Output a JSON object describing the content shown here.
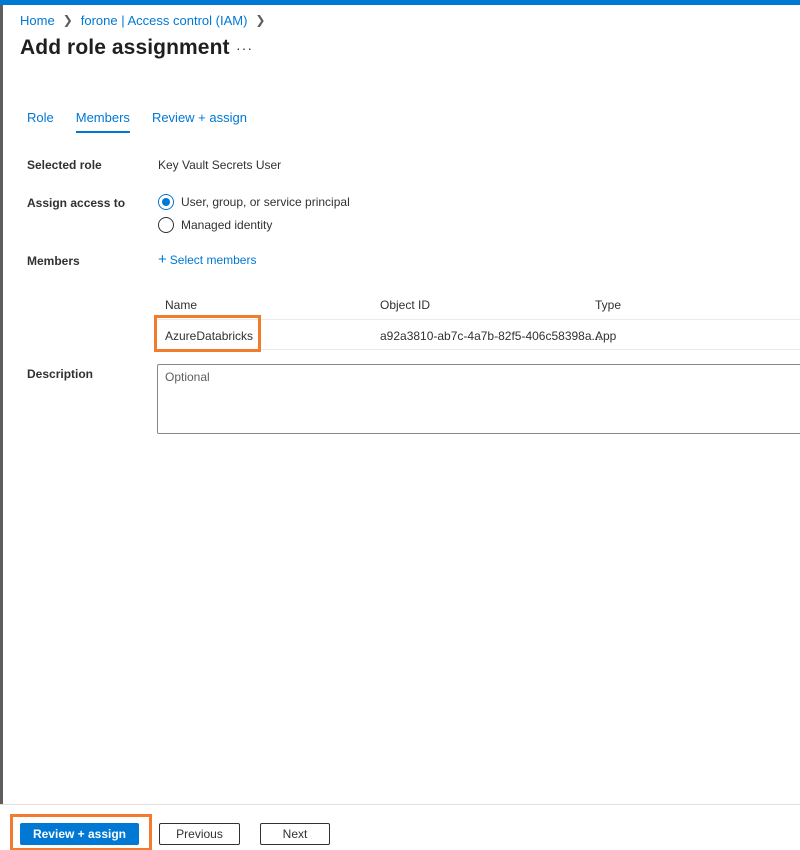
{
  "breadcrumb": {
    "items": [
      "Home",
      "forone | Access control (IAM)"
    ]
  },
  "page": {
    "title": "Add role assignment",
    "more": "···"
  },
  "tabs": [
    {
      "label": "Role"
    },
    {
      "label": "Members"
    },
    {
      "label": "Review + assign"
    }
  ],
  "form": {
    "selected_role_label": "Selected role",
    "selected_role_value": "Key Vault Secrets User",
    "assign_access_label": "Assign access to",
    "assign_options": [
      "User, group, or service principal",
      "Managed identity"
    ],
    "members_label": "Members",
    "select_members": "Select members",
    "description_label": "Description",
    "description_placeholder": "Optional"
  },
  "members_table": {
    "columns": [
      "Name",
      "Object ID",
      "Type"
    ],
    "rows": [
      {
        "name": "AzureDatabricks",
        "object_id": "a92a3810-ab7c-4a7b-82f5-406c58398a...",
        "type": "App"
      }
    ]
  },
  "footer": {
    "review_assign": "Review + assign",
    "previous": "Previous",
    "next": "Next"
  },
  "colors": {
    "accent": "#0078d4",
    "highlight": "#f27b2e"
  }
}
